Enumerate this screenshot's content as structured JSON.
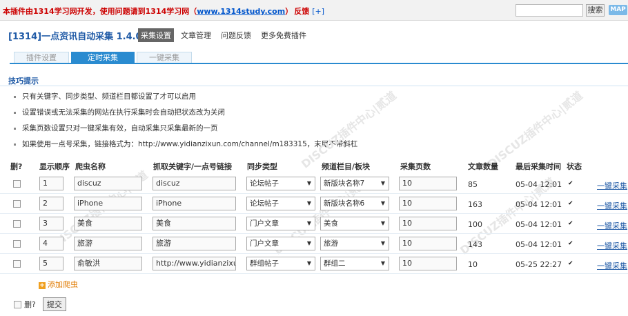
{
  "topbar": {
    "notice_prefix": "本插件由1314学习网开发，使用问题请到1314学习网（",
    "notice_link": "www.1314study.com",
    "notice_suffix": "）",
    "feedback": "反馈",
    "plus": "[+]",
    "search_placeholder": "",
    "search_button": "搜索",
    "map": "MAP"
  },
  "header": {
    "title": "[1314]一点资讯自动采集 1.4.0",
    "nav": [
      "采集设置",
      "文章管理",
      "问题反馈",
      "更多免费插件"
    ]
  },
  "tabs": [
    "插件设置",
    "定时采集",
    "一键采集"
  ],
  "tips": {
    "title": "技巧提示",
    "items": [
      "只有关键字、同步类型、频道栏目都设置了才可以启用",
      "设置错误或无法采集的网站在执行采集时会自动把状态改为关闭",
      "采集页数设置只对一键采集有效，自动采集只采集最新的一页",
      "如果使用一点号采集，链接格式为：http://www.yidianzixun.com/channel/m183315，末尾不带斜杠"
    ]
  },
  "watermark": "DISCUZ插件中心|贰道",
  "table": {
    "headers": [
      "删?",
      "显示顺序",
      "爬虫名称",
      "抓取关键字/一点号链接",
      "同步类型",
      "频道栏目/板块",
      "采集页数",
      "文章数量",
      "最后采集时间",
      "状态"
    ],
    "rows": [
      {
        "order": "1",
        "name": "discuz",
        "keyword": "discuz",
        "type": "论坛帖子",
        "channel": "新版块名称7",
        "pages": "10",
        "count": "85",
        "time": "05-04 12:01",
        "action": "一键采集"
      },
      {
        "order": "2",
        "name": "iPhone",
        "keyword": "iPhone",
        "type": "论坛帖子",
        "channel": "新版块名称6",
        "pages": "10",
        "count": "163",
        "time": "05-04 12:01",
        "action": "一键采集"
      },
      {
        "order": "3",
        "name": "美食",
        "keyword": "美食",
        "type": "门户文章",
        "channel": "美食",
        "pages": "10",
        "count": "100",
        "time": "05-04 12:01",
        "action": "一键采集"
      },
      {
        "order": "4",
        "name": "旅游",
        "keyword": "旅游",
        "type": "门户文章",
        "channel": "旅游",
        "pages": "10",
        "count": "143",
        "time": "05-04 12:01",
        "action": "一键采集"
      },
      {
        "order": "5",
        "name": "俞敏洪",
        "keyword": "http://www.yidianzixun.",
        "type": "群组帖子",
        "channel": "群组二",
        "pages": "10",
        "count": "10",
        "time": "05-25 22:27",
        "action": "一键采集"
      }
    ],
    "add_label": "添加爬虫"
  },
  "footer": {
    "delete_label": "删?",
    "submit": "提交"
  }
}
